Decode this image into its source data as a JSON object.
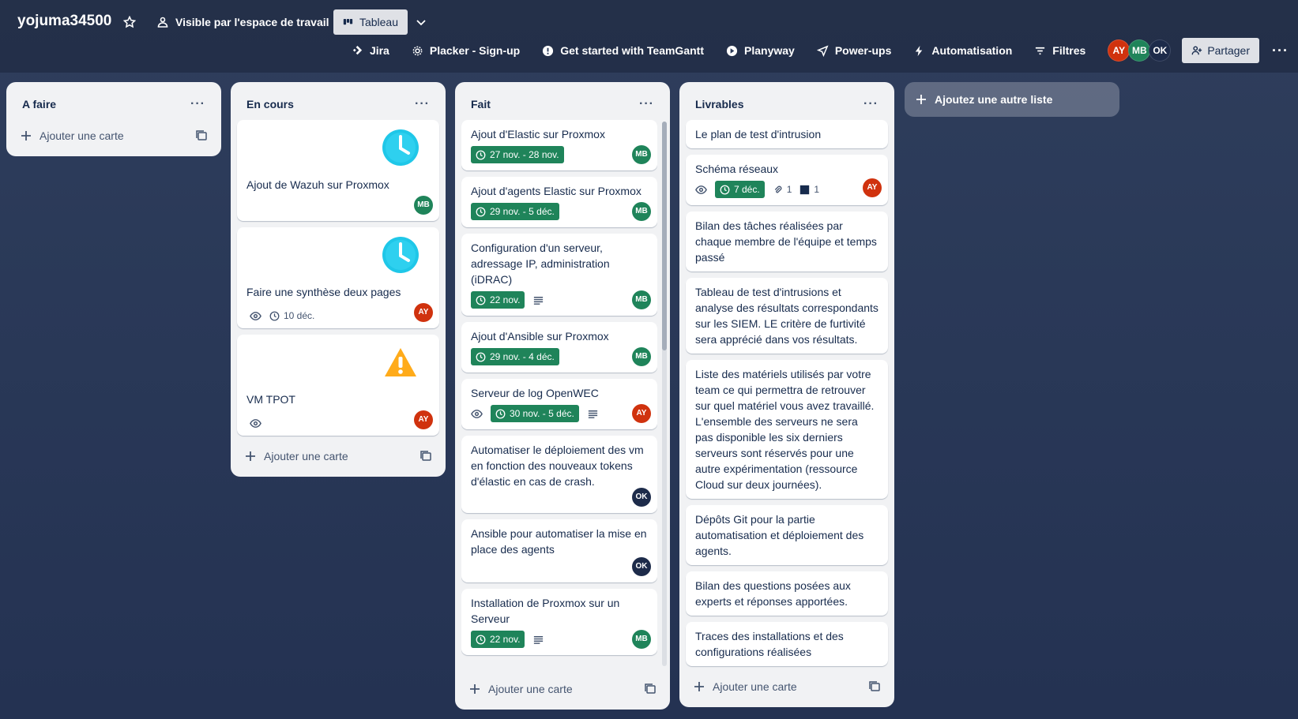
{
  "header": {
    "board_title": "yojuma34500",
    "visibility_label": "Visible par l'espace de travail",
    "view_label": "Tableau",
    "nav": {
      "jira": "Jira",
      "placker": "Placker - Sign-up",
      "teamgantt": "Get started with TeamGantt",
      "planyway": "Planyway",
      "powerups": "Power-ups",
      "automation": "Automatisation",
      "filters": "Filtres"
    },
    "members": [
      "AY",
      "MB",
      "OK"
    ],
    "share_label": "Partager"
  },
  "lists": [
    {
      "title": "A faire",
      "add_card_label": "Ajouter une carte",
      "cards": []
    },
    {
      "title": "En cours",
      "add_card_label": "Ajouter une carte",
      "cards": [
        {
          "title": "Ajout de Wazuh sur Proxmox",
          "cover": "clock-icon",
          "member": "MB"
        },
        {
          "title": "Faire une synthèse deux pages",
          "cover": "clock-icon",
          "watching": true,
          "date": "10 déc.",
          "member": "AY"
        },
        {
          "title": "VM TPOT",
          "cover": "warning-icon",
          "watching": true,
          "member": "AY"
        }
      ]
    },
    {
      "title": "Fait",
      "add_card_label": "Ajouter une carte",
      "cards": [
        {
          "title": "Ajout d'Elastic sur Proxmox",
          "date": "27 nov. - 28 nov.",
          "member": "MB"
        },
        {
          "title": "Ajout d'agents Elastic sur Proxmox",
          "date": "29 nov. - 5 déc.",
          "member": "MB"
        },
        {
          "title": "Configuration d'un serveur, adressage IP, administration (iDRAC)",
          "date": "22 nov.",
          "has_description": true,
          "member": "MB"
        },
        {
          "title": "Ajout d'Ansible sur Proxmox",
          "date": "29 nov. - 4 déc.",
          "member": "MB"
        },
        {
          "title": "Serveur de log OpenWEC",
          "watching": true,
          "date": "30 nov. - 5 déc.",
          "has_description": true,
          "member": "AY"
        },
        {
          "title": "Automatiser le déploiement des vm en fonction des nouveaux tokens d'élastic en cas de crash.",
          "member": "OK"
        },
        {
          "title": "Ansible pour automatiser la mise en place des agents",
          "member": "OK"
        },
        {
          "title": "Installation de Proxmox sur un Serveur",
          "date": "22 nov.",
          "has_description": true,
          "member": "MB"
        }
      ]
    },
    {
      "title": "Livrables",
      "add_card_label": "Ajouter une carte",
      "cards": [
        {
          "title": "Le plan de test d'intrusion"
        },
        {
          "title": "Schéma réseaux",
          "watching": true,
          "date": "7 déc.",
          "attachments": "1",
          "checklist": "1",
          "member": "AY"
        },
        {
          "title": "Bilan des tâches réalisées par chaque membre de l'équipe et temps passé"
        },
        {
          "title": "Tableau de test d'intrusions et analyse des résultats correspondants sur les SIEM. LE critère de furtivité sera apprécié dans vos résultats."
        },
        {
          "title": "Liste des matériels utilisés par votre team ce qui permettra de retrouver sur quel matériel vous avez travaillé. L'ensemble des serveurs ne sera pas disponible les six derniers serveurs sont réservés pour une autre expérimentation (ressource Cloud sur deux journées)."
        },
        {
          "title": "Dépôts Git pour la partie automatisation et déploiement des agents."
        },
        {
          "title": "Bilan des questions posées aux experts et réponses apportées."
        },
        {
          "title": "Traces des installations et des configurations réalisées"
        }
      ]
    }
  ],
  "add_list_label": "Ajoutez une autre liste",
  "colors": {
    "date_badge": "#1f845a",
    "avatar_AY": "#d0320e",
    "avatar_MB": "#1f845a",
    "avatar_OK": "#1d2b4a"
  }
}
